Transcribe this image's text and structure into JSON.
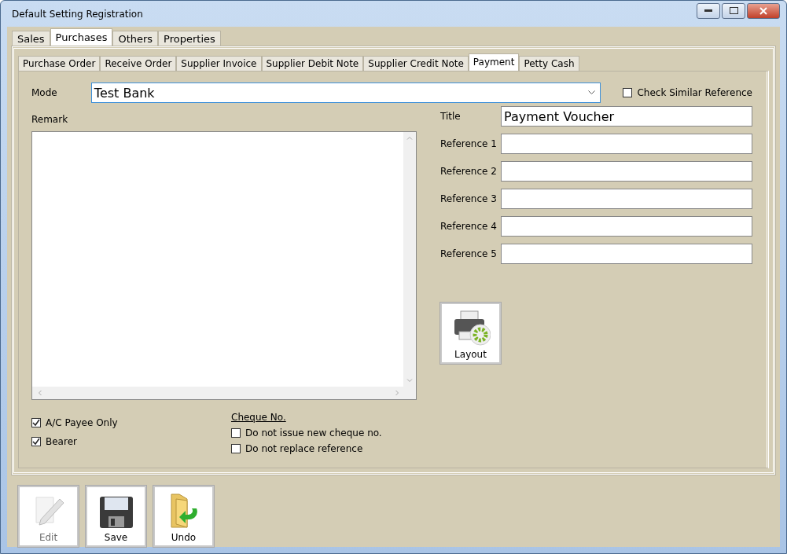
{
  "window": {
    "title": "Default Setting Registration"
  },
  "tabs": [
    {
      "label": "Sales",
      "selected": false
    },
    {
      "label": "Purchases",
      "selected": true
    },
    {
      "label": "Others",
      "selected": false
    },
    {
      "label": "Properties",
      "selected": false
    }
  ],
  "sub_tabs": [
    {
      "label": "Purchase Order",
      "selected": false
    },
    {
      "label": "Receive Order",
      "selected": false
    },
    {
      "label": "Supplier Invoice",
      "selected": false
    },
    {
      "label": "Supplier Debit Note",
      "selected": false
    },
    {
      "label": "Supplier Credit Note",
      "selected": false
    },
    {
      "label": "Payment",
      "selected": true
    },
    {
      "label": "Petty Cash",
      "selected": false
    }
  ],
  "mode": {
    "label": "Mode",
    "value": "Test Bank"
  },
  "check_similar": {
    "label": "Check Similar Reference",
    "checked": false
  },
  "remark": {
    "label": "Remark"
  },
  "fields": [
    {
      "label": "Title",
      "value": "Payment Voucher"
    },
    {
      "label": "Reference 1"
    },
    {
      "label": "Reference 2"
    },
    {
      "label": "Reference 3"
    },
    {
      "label": "Reference 4"
    },
    {
      "label": "Reference 5"
    }
  ],
  "layout_button": {
    "label": "Layout"
  },
  "options": [
    {
      "label": "A/C Payee Only",
      "checked": true
    },
    {
      "label": "Bearer",
      "checked": true
    }
  ],
  "cheque": {
    "heading": "Cheque No.",
    "options": [
      {
        "label": "Do not issue new cheque no.",
        "checked": false
      },
      {
        "label": "Do not replace reference",
        "checked": false
      }
    ]
  },
  "buttons": [
    {
      "kind": "edit",
      "label": "Edit",
      "disabled": true
    },
    {
      "kind": "save",
      "label": "Save",
      "disabled": false
    },
    {
      "kind": "undo",
      "label": "Undo",
      "disabled": false
    }
  ]
}
